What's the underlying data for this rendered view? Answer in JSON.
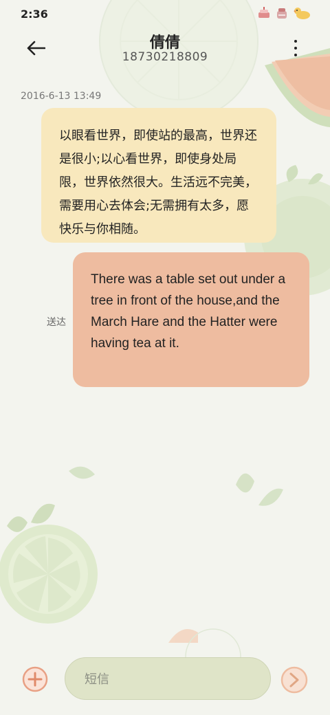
{
  "status_bar": {
    "time": "2:36",
    "icons": [
      "cake-icon",
      "cake-icon",
      "duck-icon"
    ]
  },
  "header": {
    "contact_name": "倩倩",
    "contact_number": "18730218809",
    "back_icon": "arrow-left-icon",
    "more_icon": "more-vertical-icon"
  },
  "conversation": {
    "timestamp": "2016-6-13 13:49",
    "messages": [
      {
        "direction": "incoming",
        "text": "以眼看世界，即使站的最高，世界还是很小;以心看世界，即使身处局限，世界依然很大。生活远不完美，需要用心去体会;无需拥有太多，愿快乐与你相随。"
      },
      {
        "direction": "outgoing",
        "text": "There was a table set out under a tree in front of the house,and the March Hare and the Hatter were having tea at it.",
        "status": "送达"
      }
    ]
  },
  "composer": {
    "placeholder": "短信",
    "attach_icon": "plus-circle-icon",
    "send_icon": "send-icon"
  },
  "colors": {
    "background": "#f3f4ee",
    "incoming_bubble": "#f8e8bd",
    "outgoing_bubble": "#eebca0",
    "composer": "#dfe4c8",
    "accent": "#e8a084"
  }
}
